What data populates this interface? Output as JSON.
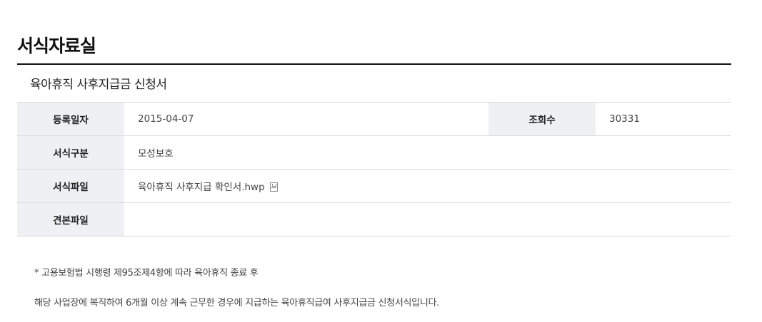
{
  "page": {
    "title": "서식자료실"
  },
  "post": {
    "subject": "육아휴직 사후지급금 신청서",
    "fields": {
      "reg_date_label": "등록일자",
      "reg_date": "2015-04-07",
      "views_label": "조회수",
      "views": "30331",
      "category_label": "서식구분",
      "category": "모성보호",
      "file_label": "서식파일",
      "file_name": "육아휴직 사후지급 확인서.hwp",
      "file_icon": "save-disk-icon",
      "sample_label": "견본파일",
      "sample_file": ""
    },
    "notes": [
      "* 고용보험법 시행령 제95조제4항에 따라 육아휴직 종료 후",
      "해당 사업장에 복직하여 6개월 이상 계속 근무한 경우에 지급하는 육아휴직급여 사후지급금 신청서식입니다."
    ]
  }
}
